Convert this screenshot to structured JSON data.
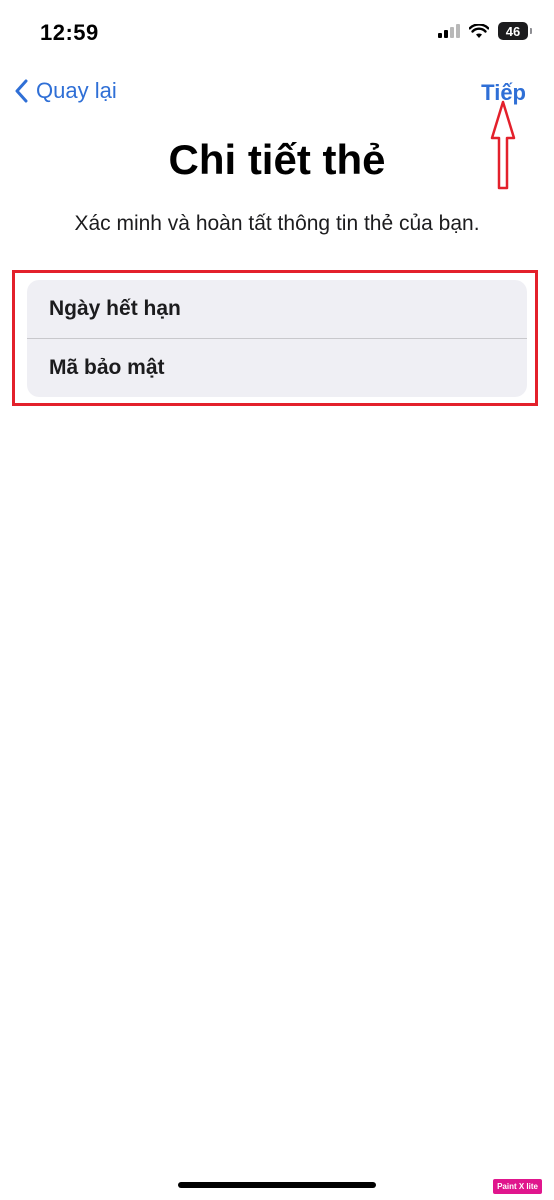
{
  "status_bar": {
    "time": "12:59",
    "battery_level": "46",
    "icons": [
      "cellular-signal-icon",
      "wifi-icon",
      "battery-icon"
    ]
  },
  "nav": {
    "back_label": "Quay lại",
    "next_label": "Tiếp",
    "icons": [
      "chevron-left-icon"
    ]
  },
  "header": {
    "title": "Chi tiết thẻ",
    "subtitle": "Xác minh và hoàn tất thông tin thẻ của bạn."
  },
  "form": {
    "fields": [
      {
        "placeholder": "Ngày hết hạn"
      },
      {
        "placeholder": "Mã bảo mật"
      }
    ]
  },
  "annotation": {
    "highlight_color": "#e3202b",
    "arrow_target": "next-button"
  },
  "watermark": {
    "text": "Paint X lite"
  },
  "colors": {
    "accent": "#2f6fd6",
    "background": "#ffffff",
    "field_background": "#efeff4"
  }
}
